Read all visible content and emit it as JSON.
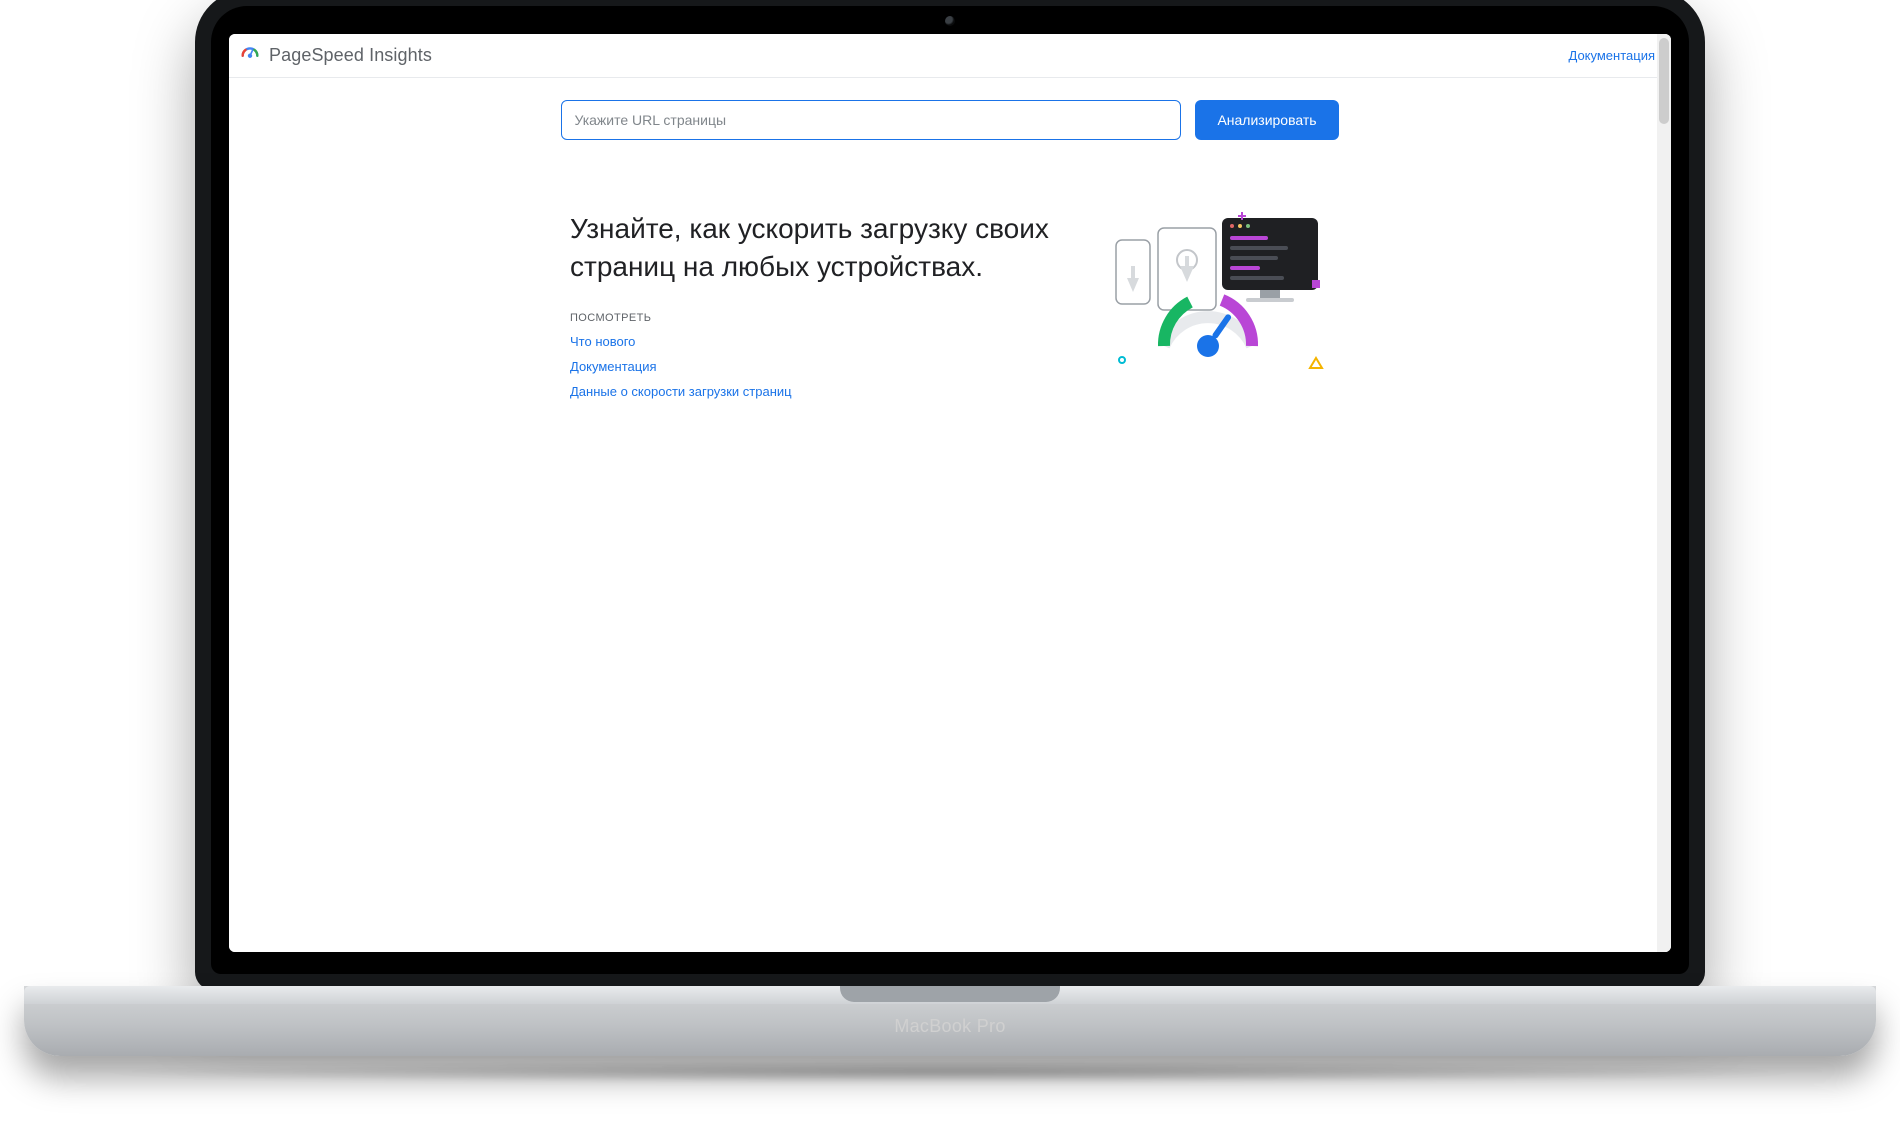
{
  "device": {
    "label": "MacBook Pro"
  },
  "header": {
    "brand": "PageSpeed Insights",
    "doc_link": "Документация"
  },
  "search": {
    "placeholder": "Укажите URL страницы",
    "value": "",
    "analyze_label": "Анализировать"
  },
  "hero": {
    "headline": "Узнайте, как ускорить загрузку своих страниц на любых устройствах.",
    "section_label": "ПОСМОТРЕТЬ",
    "links": [
      "Что нового",
      "Документация",
      "Данные о скорости загрузки страниц"
    ]
  },
  "colors": {
    "link": "#1a73e8",
    "text": "#202124",
    "muted": "#5f6368",
    "border": "#e8eaed"
  }
}
